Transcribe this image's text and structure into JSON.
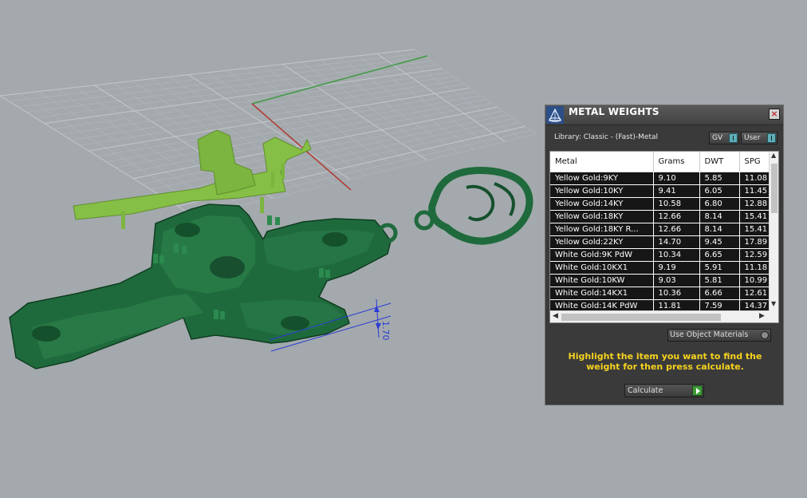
{
  "colors": {
    "viewport_bg": "#a3a9ad",
    "grid_line": "#b9bec1",
    "x_axis": "#b23b33",
    "y_axis": "#3c9a3f",
    "model_green": "#1f6a3c",
    "support_green": "#7cb53f",
    "dimension_blue": "#2a3cd6",
    "panel_bg": "#3a3a3a",
    "instruction_yellow": "#f5d21e"
  },
  "viewport": {
    "dimension_label": "1.70"
  },
  "panel": {
    "title": "METAL WEIGHTS",
    "close_label": "×",
    "library_text": "Library: Classic - (Fast)-Metal",
    "gv_label": "GV",
    "user_label": "User",
    "columns": [
      "Metal",
      "Grams",
      "DWT",
      "SPG"
    ],
    "rows": [
      [
        "Yellow Gold:9KY",
        "9.10",
        "5.85",
        "11.08"
      ],
      [
        "Yellow Gold:10KY",
        "9.41",
        "6.05",
        "11.45"
      ],
      [
        "Yellow Gold:14KY",
        "10.58",
        "6.80",
        "12.88"
      ],
      [
        "Yellow Gold:18KY",
        "12.66",
        "8.14",
        "15.41"
      ],
      [
        "Yellow Gold:18KY R...",
        "12.66",
        "8.14",
        "15.41"
      ],
      [
        "Yellow Gold:22KY",
        "14.70",
        "9.45",
        "17.89"
      ],
      [
        "White Gold:9K PdW",
        "10.34",
        "6.65",
        "12.59"
      ],
      [
        "White Gold:10KX1",
        "9.19",
        "5.91",
        "11.18"
      ],
      [
        "White Gold:10KW",
        "9.03",
        "5.81",
        "10.99"
      ],
      [
        "White Gold:14KX1",
        "10.36",
        "6.66",
        "12.61"
      ],
      [
        "White Gold:14K PdW",
        "11.81",
        "7.59",
        "14.37"
      ]
    ],
    "use_object_materials": "Use Object Materials",
    "instruction": "Highlight the item you want to find the weight for then press calculate.",
    "calculate_label": "Calculate"
  }
}
